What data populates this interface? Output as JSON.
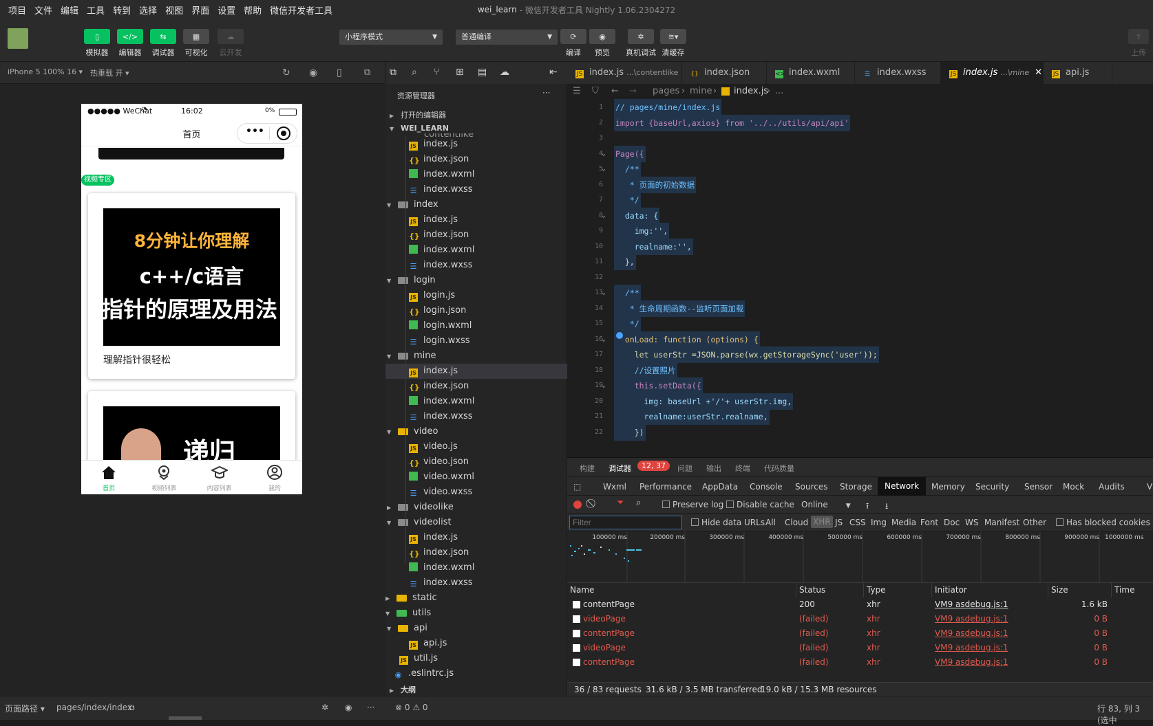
{
  "menubar": {
    "items": [
      "项目",
      "文件",
      "编辑",
      "工具",
      "转到",
      "选择",
      "视图",
      "界面",
      "设置",
      "帮助",
      "微信开发者工具"
    ]
  },
  "window": {
    "project": "wei_learn",
    "subtitle": "- 微信开发者工具 Nightly 1.06.2304272"
  },
  "toolbar": {
    "simulator": "模拟器",
    "editor": "编辑器",
    "debugger": "调试器",
    "visual": "可视化",
    "cloud": "云开发",
    "mode_select": "小程序模式",
    "compile_select": "普通编译",
    "compile": "编译",
    "preview": "预览",
    "remote_debug": "真机调试",
    "clear_cache": "清缓存",
    "upload": "上传"
  },
  "simbar": {
    "device": "iPhone 5 100% 16 ▾",
    "hotreload": "热重载 开 ▾"
  },
  "phone": {
    "carrier": "●●●●● WeChat",
    "time": "16:02",
    "battery": "0%",
    "nav_title": "首页",
    "section_tag": "视频专区",
    "card1": {
      "line1": "8分钟让你理解",
      "line2": "c++/c语言",
      "line3": "指针的原理及用法",
      "caption": "理解指针很轻松"
    },
    "card2": {
      "title": "递归"
    },
    "tabs": [
      {
        "label": "首页",
        "icon": "home-icon"
      },
      {
        "label": "视频列表",
        "icon": "location-icon"
      },
      {
        "label": "内容列表",
        "icon": "graduation-cap-icon"
      },
      {
        "label": "我的",
        "icon": "user-icon"
      }
    ]
  },
  "explorer": {
    "title": "资源管理器",
    "more": "···",
    "open_editors": "打开的编辑器",
    "root": "WEI_LEARN",
    "partial_item": "contentlike",
    "outline": "大纲",
    "tree": [
      {
        "name": "index.js",
        "type": "js",
        "depth": 3
      },
      {
        "name": "index.json",
        "type": "json",
        "depth": 3
      },
      {
        "name": "index.wxml",
        "type": "wxml",
        "depth": 3
      },
      {
        "name": "index.wxss",
        "type": "wxss",
        "depth": 3
      },
      {
        "name": "index",
        "type": "dir",
        "depth": 2,
        "open": true
      },
      {
        "name": "index.js",
        "type": "js",
        "depth": 3
      },
      {
        "name": "index.json",
        "type": "json",
        "depth": 3
      },
      {
        "name": "index.wxml",
        "type": "wxml",
        "depth": 3
      },
      {
        "name": "index.wxss",
        "type": "wxss",
        "depth": 3
      },
      {
        "name": "login",
        "type": "dir",
        "depth": 2,
        "open": true
      },
      {
        "name": "login.js",
        "type": "js",
        "depth": 3
      },
      {
        "name": "login.json",
        "type": "json",
        "depth": 3
      },
      {
        "name": "login.wxml",
        "type": "wxml",
        "depth": 3
      },
      {
        "name": "login.wxss",
        "type": "wxss",
        "depth": 3
      },
      {
        "name": "mine",
        "type": "dir",
        "depth": 2,
        "open": true
      },
      {
        "name": "index.js",
        "type": "js",
        "depth": 3,
        "selected": true
      },
      {
        "name": "index.json",
        "type": "json",
        "depth": 3
      },
      {
        "name": "index.wxml",
        "type": "wxml",
        "depth": 3
      },
      {
        "name": "index.wxss",
        "type": "wxss",
        "depth": 3
      },
      {
        "name": "video",
        "type": "dirY",
        "depth": 2,
        "open": true
      },
      {
        "name": "video.js",
        "type": "js",
        "depth": 3
      },
      {
        "name": "video.json",
        "type": "json",
        "depth": 3
      },
      {
        "name": "video.wxml",
        "type": "wxml",
        "depth": 3
      },
      {
        "name": "video.wxss",
        "type": "wxss",
        "depth": 3
      },
      {
        "name": "videolike",
        "type": "dir",
        "depth": 2,
        "open": false
      },
      {
        "name": "videolist",
        "type": "dir",
        "depth": 2,
        "open": true
      },
      {
        "name": "index.js",
        "type": "js",
        "depth": 3
      },
      {
        "name": "index.json",
        "type": "json",
        "depth": 3
      },
      {
        "name": "index.wxml",
        "type": "wxml",
        "depth": 3
      },
      {
        "name": "index.wxss",
        "type": "wxss",
        "depth": 3
      },
      {
        "name": "static",
        "type": "dirY",
        "depth": 1,
        "open": false
      },
      {
        "name": "utils",
        "type": "dirG",
        "depth": 1,
        "open": true
      },
      {
        "name": "api",
        "type": "dirY",
        "depth": 2,
        "open": true
      },
      {
        "name": "api.js",
        "type": "js",
        "depth": 3
      },
      {
        "name": "util.js",
        "type": "js",
        "depth": 2
      },
      {
        "name": ".eslintrc.js",
        "type": "eslint",
        "depth": 1
      }
    ]
  },
  "editor": {
    "tabs": [
      {
        "name": "index.js",
        "suffix": "...\\contentlike",
        "type": "js"
      },
      {
        "name": "index.json",
        "suffix": "",
        "type": "json"
      },
      {
        "name": "index.wxml",
        "suffix": "",
        "type": "wxml"
      },
      {
        "name": "index.wxss",
        "suffix": "",
        "type": "wxss"
      },
      {
        "name": "index.js",
        "suffix": "...\\mine",
        "type": "js",
        "active": true
      },
      {
        "name": "api.js",
        "suffix": "",
        "type": "js"
      }
    ],
    "breadcrumb": [
      "pages",
      "mine",
      "index.js",
      "..."
    ],
    "lines": [
      {
        "n": "1",
        "text": "// pages/mine/index.js",
        "cls": "cm"
      },
      {
        "n": "2",
        "text": "import {baseUrl,axios} from '../../utils/api/api'",
        "cls": "kw"
      },
      {
        "n": "3",
        "text": "",
        "cls": "pl"
      },
      {
        "n": "4",
        "text": "Page({",
        "cls": "kw",
        "fold": true
      },
      {
        "n": "5",
        "text": "  /**",
        "cls": "cm",
        "fold": true
      },
      {
        "n": "6",
        "text": "   * 页面的初始数据",
        "cls": "cm"
      },
      {
        "n": "7",
        "text": "   */",
        "cls": "cm"
      },
      {
        "n": "8",
        "text": "  data: {",
        "cls": "vr",
        "fold": true
      },
      {
        "n": "9",
        "text": "    img:'',",
        "cls": "vr"
      },
      {
        "n": "10",
        "text": "    realname:'',",
        "cls": "vr"
      },
      {
        "n": "11",
        "text": "  },",
        "cls": "pl"
      },
      {
        "n": "12",
        "text": "",
        "cls": "pl"
      },
      {
        "n": "13",
        "text": "  /**",
        "cls": "cm",
        "fold": true
      },
      {
        "n": "14",
        "text": "   * 生命周期函数--监听页面加载",
        "cls": "cm"
      },
      {
        "n": "15",
        "text": "   */",
        "cls": "cm"
      },
      {
        "n": "16",
        "text": "  onLoad: function (options) {",
        "cls": "kw2",
        "fold": true
      },
      {
        "n": "17",
        "text": "    let userStr =JSON.parse(wx.getStorageSync('user'));",
        "cls": "fn"
      },
      {
        "n": "18",
        "text": "    //设置照片",
        "cls": "cm"
      },
      {
        "n": "19",
        "text": "    this.setData({",
        "cls": "kw",
        "fold": true
      },
      {
        "n": "20",
        "text": "      img: baseUrl +'/'+ userStr.img,",
        "cls": "vr"
      },
      {
        "n": "21",
        "text": "      realname:userStr.realname,",
        "cls": "vr"
      },
      {
        "n": "22",
        "text": "    })",
        "cls": "pl"
      }
    ]
  },
  "devtools": {
    "top_tabs": [
      "构建",
      "调试器",
      "12, 37",
      "问题",
      "输出",
      "终端",
      "代码质量"
    ],
    "panels": [
      "Wxml",
      "Performance",
      "AppData",
      "Console",
      "Sources",
      "Storage",
      "Network",
      "Memory",
      "Security",
      "Sensor",
      "Mock",
      "Audits",
      "Vi"
    ],
    "preserve_log": "Preserve log",
    "disable_cache": "Disable cache",
    "online": "Online",
    "filter_placeholder": "Filter",
    "filter_types": [
      "Hide data URLs",
      "All",
      "Cloud",
      "XHR",
      "JS",
      "CSS",
      "Img",
      "Media",
      "Font",
      "Doc",
      "WS",
      "Manifest",
      "Other",
      "Has blocked cookies"
    ],
    "ticks": [
      "100000 ms",
      "200000 ms",
      "300000 ms",
      "400000 ms",
      "500000 ms",
      "600000 ms",
      "700000 ms",
      "800000 ms",
      "900000 ms",
      "1000000 ms"
    ],
    "columns": [
      "Name",
      "Status",
      "Type",
      "Initiator",
      "Size",
      "Time"
    ],
    "rows": [
      {
        "name": "contentPage",
        "status": "200",
        "type": "xhr",
        "initiator": "VM9 asdebug.js:1",
        "size": "1.6 kB",
        "ok": true
      },
      {
        "name": "videoPage",
        "status": "(failed)",
        "type": "xhr",
        "initiator": "VM9 asdebug.js:1",
        "size": "0 B",
        "ok": false
      },
      {
        "name": "contentPage",
        "status": "(failed)",
        "type": "xhr",
        "initiator": "VM9 asdebug.js:1",
        "size": "0 B",
        "ok": false
      },
      {
        "name": "videoPage",
        "status": "(failed)",
        "type": "xhr",
        "initiator": "VM9 asdebug.js:1",
        "size": "0 B",
        "ok": false
      },
      {
        "name": "contentPage",
        "status": "(failed)",
        "type": "xhr",
        "initiator": "VM9 asdebug.js:1",
        "size": "0 B",
        "ok": false
      }
    ],
    "summary": {
      "requests": "36 / 83 requests",
      "transferred": "31.6 kB / 3.5 MB transferred",
      "resources": "19.0 kB / 15.3 MB resources"
    }
  },
  "footer": {
    "page_path_label": "页面路径 ▾",
    "page_path": "pages/index/index",
    "problems": "⊗ 0 ⚠ 0",
    "cursor": "行 83, 列 3 (选中"
  },
  "colors": {
    "accent": "#07c160",
    "error": "#e05a4e",
    "selection": "#37373d"
  }
}
